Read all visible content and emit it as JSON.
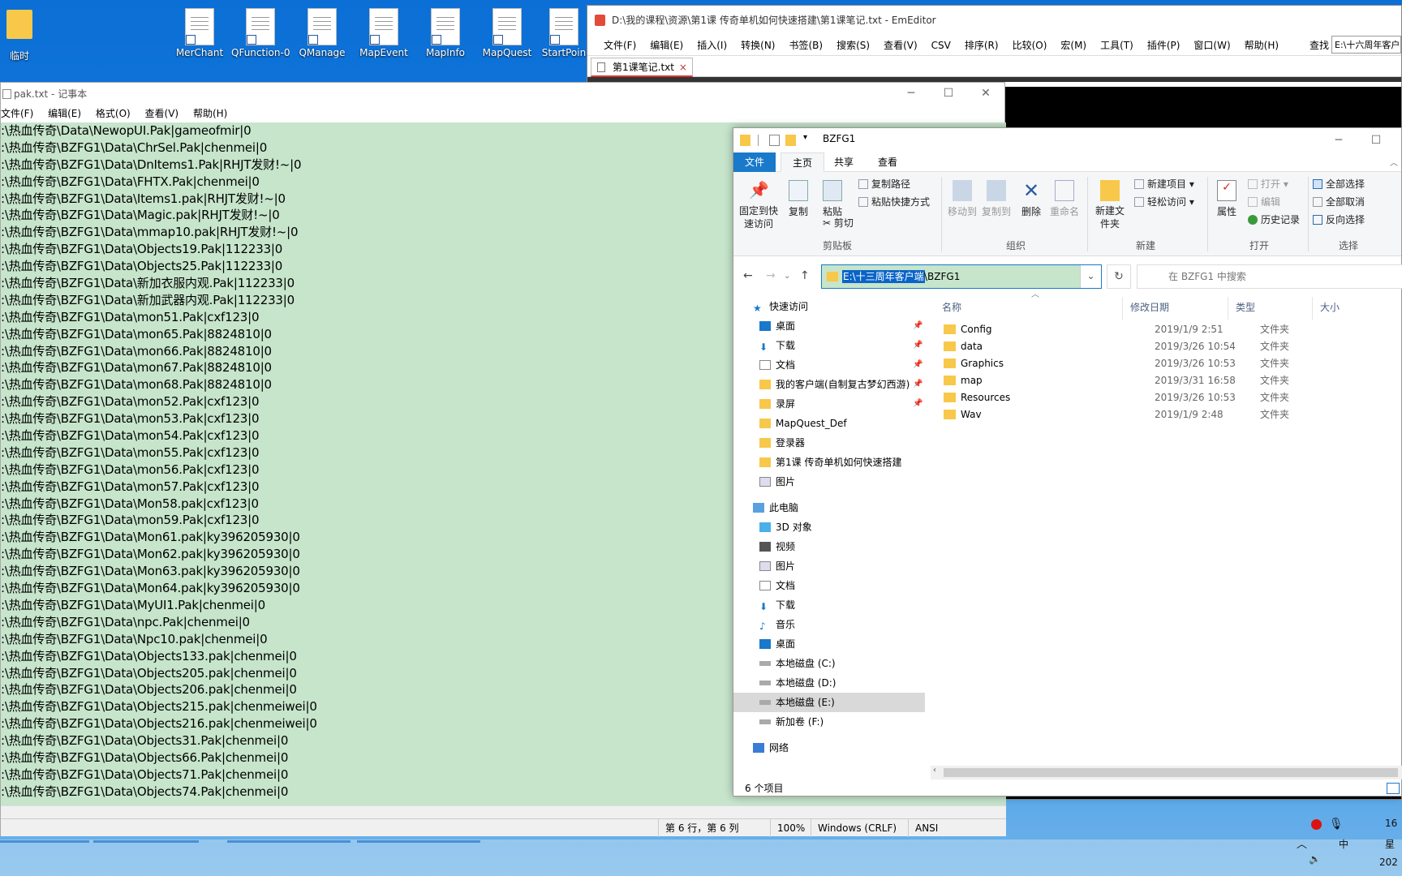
{
  "desktop": {
    "icons": [
      {
        "label": "临时",
        "kind": "folder"
      },
      {
        "label": "MerChant",
        "kind": "doc"
      },
      {
        "label": "QFunction-0",
        "kind": "doc"
      },
      {
        "label": "QManage",
        "kind": "doc"
      },
      {
        "label": "MapEvent",
        "kind": "doc"
      },
      {
        "label": "MapInfo",
        "kind": "doc"
      },
      {
        "label": "MapQuest",
        "kind": "doc"
      },
      {
        "label": "StartPoin",
        "kind": "doc"
      }
    ]
  },
  "emeditor": {
    "title": "D:\\我的课程\\资源\\第1课 传奇单机如何快速搭建\\第1课笔记.txt - EmEditor",
    "menu": [
      "文件(F)",
      "编辑(E)",
      "插入(I)",
      "转换(N)",
      "书签(B)",
      "搜索(S)",
      "查看(V)",
      "CSV",
      "排序(R)",
      "比较(O)",
      "宏(M)",
      "工具(T)",
      "插件(P)",
      "窗口(W)",
      "帮助(H)"
    ],
    "find_label": "查找",
    "find_value": "E:\\十六周年客户",
    "tab_label": "第1课笔记.txt",
    "tab_close": "×"
  },
  "notepad": {
    "title": "pak.txt - 记事本",
    "menu": [
      "文件(F)",
      "编辑(E)",
      "格式(O)",
      "查看(V)",
      "帮助(H)"
    ],
    "lines": [
      ":\\热血传奇\\Data\\NewopUI.Pak|gameofmir|0",
      ":\\热血传奇\\BZFG1\\Data\\ChrSel.Pak|chenmei|0",
      ":\\热血传奇\\BZFG1\\Data\\DnItems1.Pak|RHJT发财!~|0",
      ":\\热血传奇\\BZFG1\\Data\\FHTX.Pak|chenmei|0",
      ":\\热血传奇\\BZFG1\\Data\\Items1.pak|RHJT发财!~|0",
      ":\\热血传奇\\BZFG1\\Data\\Magic.pak|RHJT发财!~|0",
      ":\\热血传奇\\BZFG1\\Data\\mmap10.pak|RHJT发财!~|0",
      ":\\热血传奇\\BZFG1\\Data\\Objects19.Pak|112233|0",
      ":\\热血传奇\\BZFG1\\Data\\Objects25.Pak|112233|0",
      ":\\热血传奇\\BZFG1\\Data\\新加衣服内观.Pak|112233|0",
      ":\\热血传奇\\BZFG1\\Data\\新加武器内观.Pak|112233|0",
      ":\\热血传奇\\BZFG1\\Data\\mon51.Pak|cxf123|0",
      ":\\热血传奇\\BZFG1\\Data\\mon65.Pak|8824810|0",
      ":\\热血传奇\\BZFG1\\Data\\mon66.Pak|8824810|0",
      ":\\热血传奇\\BZFG1\\Data\\mon67.Pak|8824810|0",
      ":\\热血传奇\\BZFG1\\Data\\mon68.Pak|8824810|0",
      ":\\热血传奇\\BZFG1\\Data\\mon52.Pak|cxf123|0",
      ":\\热血传奇\\BZFG1\\Data\\mon53.Pak|cxf123|0",
      ":\\热血传奇\\BZFG1\\Data\\mon54.Pak|cxf123|0",
      ":\\热血传奇\\BZFG1\\Data\\mon55.Pak|cxf123|0",
      ":\\热血传奇\\BZFG1\\Data\\mon56.Pak|cxf123|0",
      ":\\热血传奇\\BZFG1\\Data\\mon57.Pak|cxf123|0",
      ":\\热血传奇\\BZFG1\\Data\\Mon58.pak|cxf123|0",
      ":\\热血传奇\\BZFG1\\Data\\mon59.Pak|cxf123|0",
      ":\\热血传奇\\BZFG1\\Data\\Mon61.pak|ky396205930|0",
      ":\\热血传奇\\BZFG1\\Data\\Mon62.pak|ky396205930|0",
      ":\\热血传奇\\BZFG1\\Data\\Mon63.pak|ky396205930|0",
      ":\\热血传奇\\BZFG1\\Data\\Mon64.pak|ky396205930|0",
      ":\\热血传奇\\BZFG1\\Data\\MyUI1.Pak|chenmei|0",
      ":\\热血传奇\\BZFG1\\Data\\npc.Pak|chenmei|0",
      ":\\热血传奇\\BZFG1\\Data\\Npc10.pak|chenmei|0",
      ":\\热血传奇\\BZFG1\\Data\\Objects133.pak|chenmei|0",
      ":\\热血传奇\\BZFG1\\Data\\Objects205.pak|chenmei|0",
      ":\\热血传奇\\BZFG1\\Data\\Objects206.pak|chenmei|0",
      ":\\热血传奇\\BZFG1\\Data\\Objects215.pak|chenmeiwei|0",
      ":\\热血传奇\\BZFG1\\Data\\Objects216.pak|chenmeiwei|0",
      ":\\热血传奇\\BZFG1\\Data\\Objects31.Pak|chenmei|0",
      ":\\热血传奇\\BZFG1\\Data\\Objects66.Pak|chenmei|0",
      ":\\热血传奇\\BZFG1\\Data\\Objects71.Pak|chenmei|0",
      ":\\热血传奇\\BZFG1\\Data\\Objects74.Pak|chenmei|0"
    ],
    "status": {
      "position": "第 6 行，第 6 列",
      "zoom": "100%",
      "eol": "Windows (CRLF)",
      "encoding": "ANSI"
    }
  },
  "explorer": {
    "title": "BZFG1",
    "tabs": [
      "文件",
      "主页",
      "共享",
      "查看"
    ],
    "ribbon": {
      "pin": "固定到快速访问",
      "copy": "复制",
      "paste": "粘贴",
      "copy_path": "复制路径",
      "paste_shortcut": "粘贴快捷方式",
      "cut": "剪切",
      "group_clipboard": "剪贴板",
      "move_to": "移动到",
      "copy_to": "复制到",
      "delete": "删除",
      "rename": "重命名",
      "group_organize": "组织",
      "new_folder": "新建文件夹",
      "new_item": "新建项目",
      "easy_access": "轻松访问",
      "group_new": "新建",
      "properties": "属性",
      "open": "打开",
      "edit": "编辑",
      "history": "历史记录",
      "group_open": "打开",
      "select_all": "全部选择",
      "select_none": "全部取消",
      "invert": "反向选择",
      "group_select": "选择"
    },
    "address_selected": "E:\\十三周年客户端",
    "address_rest": "\\BZFG1",
    "search_placeholder": "在 BZFG1 中搜索",
    "tree": [
      {
        "label": "快速访问",
        "indent": 0,
        "icon": "star",
        "pin": false
      },
      {
        "label": "桌面",
        "indent": 1,
        "icon": "desktop",
        "pin": true
      },
      {
        "label": "下载",
        "indent": 1,
        "icon": "download",
        "pin": true
      },
      {
        "label": "文档",
        "indent": 1,
        "icon": "document",
        "pin": true
      },
      {
        "label": "我的客户端(自制复古梦幻西游)",
        "indent": 1,
        "icon": "folder",
        "pin": true
      },
      {
        "label": "录屏",
        "indent": 1,
        "icon": "folder",
        "pin": true
      },
      {
        "label": "MapQuest_Def",
        "indent": 1,
        "icon": "folder",
        "pin": false
      },
      {
        "label": "登录器",
        "indent": 1,
        "icon": "folder",
        "pin": false
      },
      {
        "label": "第1课 传奇单机如何快速搭建",
        "indent": 1,
        "icon": "folder",
        "pin": false
      },
      {
        "label": "图片",
        "indent": 1,
        "icon": "pictures",
        "pin": false
      },
      {
        "label": "此电脑",
        "indent": 0,
        "icon": "pc",
        "pin": false
      },
      {
        "label": "3D 对象",
        "indent": 1,
        "icon": "3d",
        "pin": false
      },
      {
        "label": "视频",
        "indent": 1,
        "icon": "video",
        "pin": false
      },
      {
        "label": "图片",
        "indent": 1,
        "icon": "pictures",
        "pin": false
      },
      {
        "label": "文档",
        "indent": 1,
        "icon": "document",
        "pin": false
      },
      {
        "label": "下载",
        "indent": 1,
        "icon": "download",
        "pin": false
      },
      {
        "label": "音乐",
        "indent": 1,
        "icon": "music",
        "pin": false
      },
      {
        "label": "桌面",
        "indent": 1,
        "icon": "desktop",
        "pin": false
      },
      {
        "label": "本地磁盘 (C:)",
        "indent": 1,
        "icon": "drive",
        "pin": false
      },
      {
        "label": "本地磁盘 (D:)",
        "indent": 1,
        "icon": "drive",
        "pin": false
      },
      {
        "label": "本地磁盘 (E:)",
        "indent": 1,
        "icon": "drive",
        "pin": false,
        "selected": true
      },
      {
        "label": "新加卷 (F:)",
        "indent": 1,
        "icon": "drive",
        "pin": false
      },
      {
        "label": "网络",
        "indent": 0,
        "icon": "network",
        "pin": false
      }
    ],
    "columns": [
      "名称",
      "修改日期",
      "类型",
      "大小"
    ],
    "files": [
      {
        "name": "Config",
        "date": "2019/1/9 2:51",
        "type": "文件夹"
      },
      {
        "name": "data",
        "date": "2019/3/26 10:54",
        "type": "文件夹"
      },
      {
        "name": "Graphics",
        "date": "2019/3/26 10:53",
        "type": "文件夹"
      },
      {
        "name": "map",
        "date": "2019/3/31 16:58",
        "type": "文件夹"
      },
      {
        "name": "Resources",
        "date": "2019/3/26 10:53",
        "type": "文件夹"
      },
      {
        "name": "Wav",
        "date": "2019/1/9 2:48",
        "type": "文件夹"
      }
    ],
    "status": "6 个项目"
  },
  "tray": {
    "ime": "中",
    "clock_partial": "16",
    "day_partial": "星",
    "year_partial": "202"
  },
  "colors": {
    "selection": "#0a64c8",
    "notepad_bg": "#c6e5cb",
    "ribbon_file": "#1979ca",
    "folder": "#f7c84a"
  }
}
